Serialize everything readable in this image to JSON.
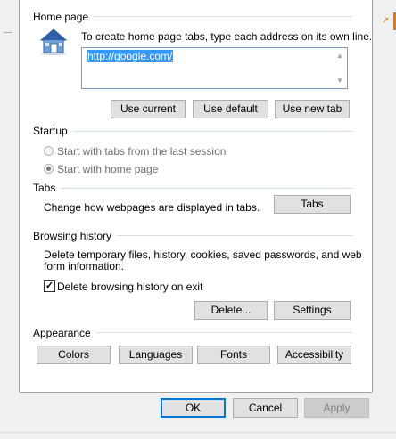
{
  "home_page": {
    "section_title": "Home page",
    "instruction": "To create home page tabs, type each address on its own line.",
    "url_value": "http://google.com/",
    "buttons": {
      "use_current": "Use current",
      "use_default": "Use default",
      "use_new_tab": "Use new tab"
    }
  },
  "startup": {
    "section_title": "Startup",
    "options": [
      {
        "label": "Start with tabs from the last session",
        "checked": false
      },
      {
        "label": "Start with home page",
        "checked": true
      }
    ]
  },
  "tabs": {
    "section_title": "Tabs",
    "description": "Change how webpages are displayed in tabs.",
    "button": "Tabs"
  },
  "browsing_history": {
    "section_title": "Browsing history",
    "description_line1": "Delete temporary files, history, cookies, saved passwords, and web",
    "description_line2": "form information.",
    "checkbox_label": "Delete browsing history on exit",
    "checkbox_checked": true,
    "buttons": {
      "delete": "Delete...",
      "settings": "Settings"
    }
  },
  "appearance": {
    "section_title": "Appearance",
    "buttons": {
      "colors": "Colors",
      "languages": "Languages",
      "fonts": "Fonts",
      "accessibility": "Accessibility"
    }
  },
  "footer": {
    "ok": "OK",
    "cancel": "Cancel",
    "apply": "Apply"
  },
  "colors": {
    "accent": "#0078d7",
    "selection": "#3399ff",
    "window_bg": "#f0f0f0",
    "panel_bg": "#ffffff",
    "edge_mark": "#e27a1b"
  },
  "icons": {
    "home": "house-icon",
    "check": "checkmark-icon",
    "scroll_up": "chevron-up-icon",
    "scroll_down": "chevron-down-icon"
  }
}
